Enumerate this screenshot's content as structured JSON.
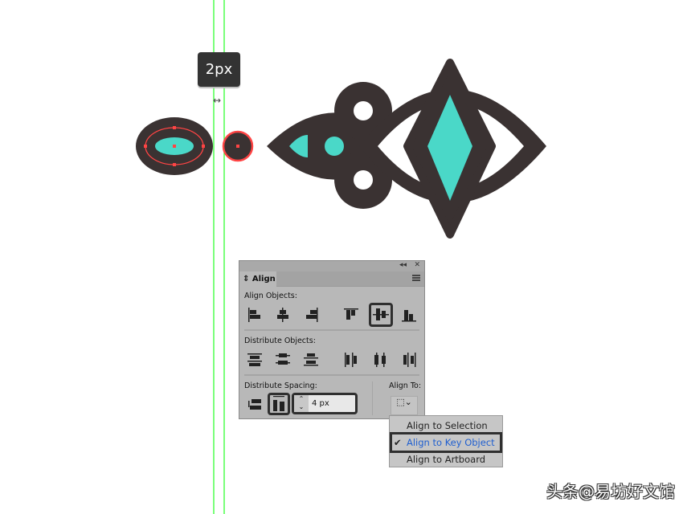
{
  "canvas": {
    "tooltip": "2px",
    "colors": {
      "dark": "#3a3232",
      "teal": "#4ad8c8",
      "guide": "#33ff33",
      "selection": "#ff4444"
    }
  },
  "panel": {
    "tab": "Align",
    "align_objects_label": "Align Objects:",
    "distribute_objects_label": "Distribute Objects:",
    "distribute_spacing_label": "Distribute Spacing:",
    "align_to_label": "Align To:",
    "spacing_value": "4 px",
    "selected_align_button": "vertical-align-center"
  },
  "dropdown": {
    "items": [
      "Align to Selection",
      "Align to Key Object",
      "Align to Artboard"
    ],
    "selected": "Align to Key Object"
  },
  "watermark": "头条@易坊好文馆"
}
